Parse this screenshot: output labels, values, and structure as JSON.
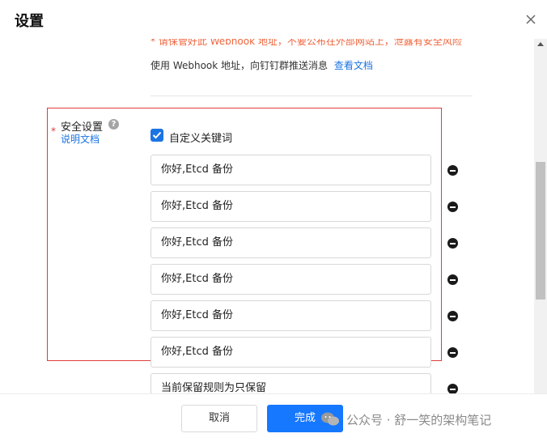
{
  "dialog": {
    "title": "设置"
  },
  "webhook": {
    "warning": "* 请保管好此 Webhook 地址，不要公布在外部网站上，泄露有安全风险",
    "usage_text": "使用 Webhook 地址，向钉钉群推送消息",
    "usage_link": "查看文档"
  },
  "security": {
    "required_mark": "*",
    "label": "安全设置",
    "help_icon": "question-circle-icon",
    "doc_link": "说明文档",
    "keyword_checkbox_label": "自定义关键词",
    "keyword_checked": true,
    "keywords": [
      "你好,Etcd 备份",
      "你好,Etcd 备份",
      "你好,Etcd 备份",
      "你好,Etcd 备份",
      "你好,Etcd 备份",
      "你好,Etcd 备份",
      "当前保留规则为只保留"
    ]
  },
  "footer": {
    "cancel_label": "取消",
    "ok_label": "完成",
    "watermark": "公众号 · 舒一笑的架构笔记"
  },
  "colors": {
    "primary": "#1677ff",
    "link": "#1b74e4",
    "warning": "#f0643c",
    "highlight_border": "#e23b3b"
  }
}
